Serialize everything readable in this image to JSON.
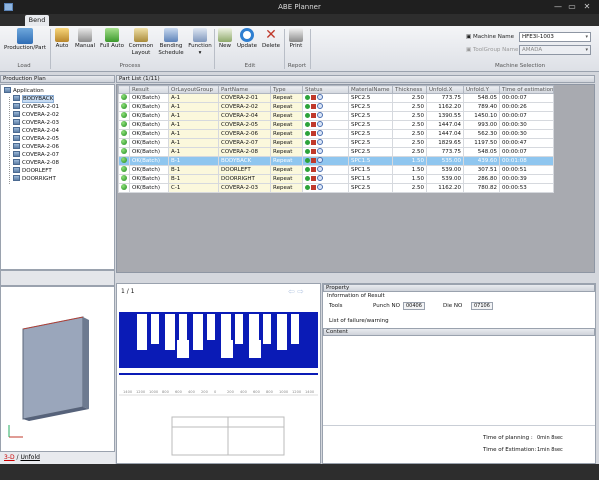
{
  "window": {
    "title": "ABE Planner",
    "tab": "Bend",
    "controls": {
      "minimize": "—",
      "maximize": "▭",
      "close": "✕"
    }
  },
  "ribbon": {
    "groups": {
      "load": "Load",
      "process": "Process",
      "edit": "Edit",
      "report": "Report",
      "machine": "Machine Selection"
    },
    "buttons": {
      "production_part": "Production/Part",
      "auto": "Auto",
      "manual": "Manual",
      "full_auto": "Full Auto",
      "common_layout_1": "Common",
      "common_layout_2": "Layout",
      "bending_schedule_1": "Bending",
      "bending_schedule_2": "Schedule",
      "function": "Function",
      "new": "New",
      "update": "Update",
      "delete": "Delete",
      "print": "Print"
    },
    "machine": {
      "label": "Machine Name",
      "value": "HFE3I-1003",
      "toolgroup_label": "ToolGroup Name",
      "toolgroup_value": "AMADA"
    }
  },
  "production_plan": {
    "header": "Production Plan",
    "root": "Application",
    "items": [
      "BODYBACK",
      "COVERA-2-01",
      "COVERA-2-02",
      "COVERA-2-03",
      "COVERA-2-04",
      "COVERA-2-05",
      "COVERA-2-06",
      "COVERA-2-07",
      "COVERA-2-08",
      "DOORLEFT",
      "DOORRIGHT"
    ],
    "selected": "BODYBACK"
  },
  "preview": {
    "links": {
      "three_d": "3-D",
      "separator": "/",
      "unfold": "Unfold"
    }
  },
  "part_list": {
    "header": "Part List (1/11)",
    "columns": [
      "",
      "Result",
      "OrLayoutGroup",
      "PartName",
      "Type",
      "Status",
      "MaterialName",
      "Thickness",
      "Unfold.X",
      "Unfold.Y",
      "Time of estimation"
    ],
    "rows": [
      [
        "OK(Batch)",
        "A-1",
        "COVERA-2-01",
        "Repeat",
        "SPC2.5",
        "2.50",
        "773.75",
        "548.05",
        "00:00:07"
      ],
      [
        "OK(Batch)",
        "A-1",
        "COVERA-2-02",
        "Repeat",
        "SPC2.5",
        "2.50",
        "1162.20",
        "789.40",
        "00:00:26"
      ],
      [
        "OK(Batch)",
        "A-1",
        "COVERA-2-04",
        "Repeat",
        "SPC2.5",
        "2.50",
        "1390.55",
        "1450.10",
        "00:00:07"
      ],
      [
        "OK(Batch)",
        "A-1",
        "COVERA-2-05",
        "Repeat",
        "SPC2.5",
        "2.50",
        "1447.04",
        "993.00",
        "00:00:30"
      ],
      [
        "OK(Batch)",
        "A-1",
        "COVERA-2-06",
        "Repeat",
        "SPC2.5",
        "2.50",
        "1447.04",
        "562.30",
        "00:00:30"
      ],
      [
        "OK(Batch)",
        "A-1",
        "COVERA-2-07",
        "Repeat",
        "SPC2.5",
        "2.50",
        "1829.65",
        "1197.50",
        "00:00:47"
      ],
      [
        "OK(Batch)",
        "A-1",
        "COVERA-2-08",
        "Repeat",
        "SPC2.5",
        "2.50",
        "773.75",
        "548.05",
        "00:00:07"
      ],
      [
        "OK(Batch)",
        "B-1",
        "BODYBACK",
        "Repeat",
        "SPC1.5",
        "1.50",
        "535.00",
        "439.60",
        "00:01:08"
      ],
      [
        "OK(Batch)",
        "B-1",
        "DOORLEFT",
        "Repeat",
        "SPC1.5",
        "1.50",
        "539.00",
        "307.51",
        "00:00:51"
      ],
      [
        "OK(Batch)",
        "B-1",
        "DOORRIGHT",
        "Repeat",
        "SPC1.5",
        "1.50",
        "539.00",
        "286.80",
        "00:00:39"
      ],
      [
        "OK(Batch)",
        "C-1",
        "COVERA-2-03",
        "Repeat",
        "SPC2.5",
        "2.50",
        "1162.20",
        "780.82",
        "00:00:53"
      ]
    ],
    "selected_row": 7
  },
  "bend_view": {
    "page": "1 / 1",
    "arrows": "⇦ ⇨",
    "scale": [
      "1400",
      "1200",
      "1000",
      "800",
      "600",
      "400",
      "200",
      "0",
      "200",
      "400",
      "600",
      "800",
      "1000",
      "1200",
      "1400"
    ]
  },
  "property": {
    "header": "Property",
    "info_title": "Information of Result",
    "tools_label": "Tools",
    "punch_label": "Punch NO",
    "punch_value": "00406",
    "die_label": "Die NO",
    "die_value": "07106",
    "failure_label": "List of failure/warning",
    "content_header": "Content",
    "time_planning_label": "Time of planning :",
    "time_planning_value": "0min 8sec",
    "time_estimation_label": "Time of Estimation:",
    "time_estimation_value": "1min 8sec"
  }
}
